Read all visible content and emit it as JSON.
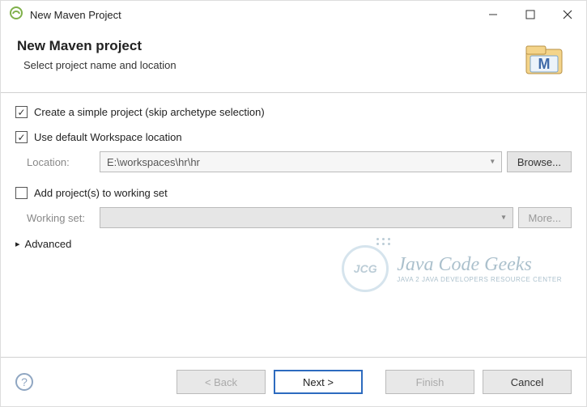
{
  "window": {
    "title": "New Maven Project"
  },
  "banner": {
    "heading": "New Maven project",
    "subtitle": "Select project name and location"
  },
  "options": {
    "simple_project": {
      "label": "Create a simple project (skip archetype selection)",
      "checked": true
    },
    "default_workspace": {
      "label": "Use default Workspace location",
      "checked": true
    },
    "location_label": "Location:",
    "location_value": "E:\\workspaces\\hr\\hr",
    "browse": "Browse...",
    "add_working_set": {
      "label": "Add project(s) to working set",
      "checked": false
    },
    "working_set_label": "Working set:",
    "working_set_value": "",
    "more": "More...",
    "advanced": "Advanced"
  },
  "watermark": {
    "logo_text": "JCG",
    "main": "Java Code Geeks",
    "tagline": "Java 2 Java Developers Resource Center"
  },
  "buttons": {
    "back": "< Back",
    "next": "Next >",
    "finish": "Finish",
    "cancel": "Cancel"
  }
}
